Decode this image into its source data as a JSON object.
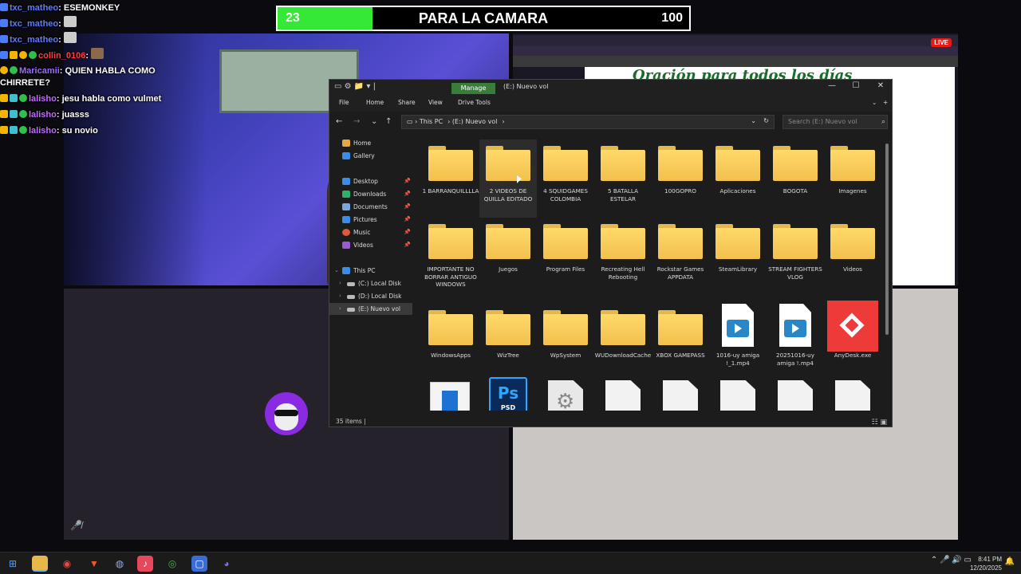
{
  "goal": {
    "current": "23",
    "title": "PARA LA CAMARA",
    "max": "100",
    "progress": 0.23
  },
  "chat": [
    {
      "user": "txc_matheo",
      "msg": "ESEMONKEY"
    },
    {
      "user": "txc_matheo",
      "msg": ""
    },
    {
      "user": "txc_matheo",
      "msg": ""
    },
    {
      "user": "collin_0106",
      "msg": ""
    },
    {
      "user": "Maricamii",
      "msg": "QUIEN HABLA COMO CHIRRETE?"
    },
    {
      "user": "lalisho",
      "msg": "jesu habla como vulmet"
    },
    {
      "user": "lalisho",
      "msg": "juasss"
    },
    {
      "user": "lalisho",
      "msg": "su novio"
    }
  ],
  "stream": {
    "live_badge": "LIVE",
    "pdf_heading": "Oración para todos los días"
  },
  "explorer": {
    "title": "(E:) Nuevo vol",
    "manage_label": "Manage",
    "ribbon": [
      "File",
      "Home",
      "Share",
      "View",
      "Drive Tools"
    ],
    "breadcrumb": [
      "This PC",
      "(E:) Nuevo vol"
    ],
    "search_placeholder": "Search (E:) Nuevo vol",
    "sidebar": {
      "quick": [
        "Home",
        "Gallery"
      ],
      "pinned": [
        "Desktop",
        "Downloads",
        "Documents",
        "Pictures",
        "Music",
        "Videos"
      ],
      "this_pc": "This PC",
      "drives": [
        "(C:) Local Disk",
        "(D:) Local Disk",
        "(E:) Nuevo vol"
      ]
    },
    "items": [
      "1 BARRANQUILLLLA",
      "2 VIDEOS DE QUILLA EDITADO",
      "4 SQUIDGAMES COLOMBIA",
      "5 BATALLA ESTELAR",
      "100GOPRO",
      "Aplicaciones",
      "BOGOTA",
      "Imagenes",
      "IMPORTANTE NO BORRAR ANTIGUO WINDOWS",
      "Juegos",
      "Program Files",
      "Recreating Hell Rebooting",
      "Rockstar Games APPDATA",
      "SteamLibrary",
      "STREAM FIGHTERS VLOG",
      "Videos",
      "WindowsApps",
      "WizTree",
      "WpSystem",
      "WUDownloadCache",
      "XBOX GAMEPASS",
      "1016-uy amiga !_1.mp4",
      "20251016-uy amiga !.mp4",
      "AnyDesk.exe"
    ],
    "status": "35 items"
  },
  "taskbar": {
    "time": "8:41 PM",
    "date": "12/20/2025"
  }
}
